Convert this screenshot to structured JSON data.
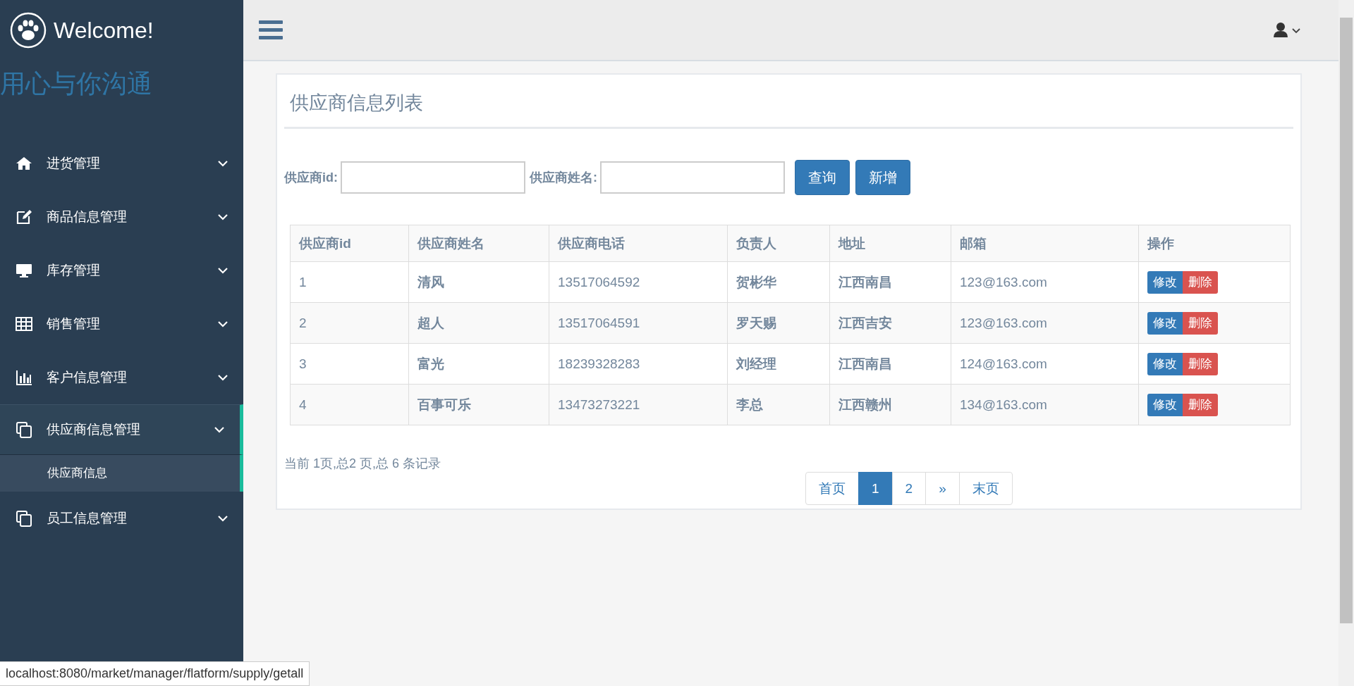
{
  "sidebar": {
    "brand": "Welcome!",
    "slogan": "用心与你沟通",
    "items": [
      {
        "label": "进货管理",
        "expanded": false
      },
      {
        "label": "商品信息管理",
        "expanded": false
      },
      {
        "label": "库存管理",
        "expanded": false
      },
      {
        "label": "销售管理",
        "expanded": false
      },
      {
        "label": "客户信息管理",
        "expanded": false
      },
      {
        "label": "供应商信息管理",
        "expanded": true,
        "children": [
          {
            "label": "供应商信息",
            "selected": true
          }
        ]
      },
      {
        "label": "员工信息管理",
        "expanded": false
      }
    ]
  },
  "panel": {
    "title": "供应商信息列表",
    "filters": [
      {
        "label": "供应商id:"
      },
      {
        "label": "供应商姓名:"
      }
    ],
    "buttons": [
      "查询",
      "新增"
    ],
    "table": {
      "columns": [
        "供应商id",
        "供应商姓名",
        "供应商电话",
        "负责人",
        "地址",
        "邮箱",
        "操作"
      ],
      "rows": [
        {
          "cells": [
            "1",
            "清风",
            "13517064592",
            "贺彬华",
            "江西南昌",
            "123@163.com"
          ],
          "actions": [
            "修改",
            "删除"
          ]
        },
        {
          "cells": [
            "2",
            "超人",
            "13517064591",
            "罗天赐",
            "江西吉安",
            "123@163.com"
          ],
          "actions": [
            "修改",
            "删除"
          ]
        },
        {
          "cells": [
            "3",
            "富光",
            "18239328283",
            "刘经理",
            "江西南昌",
            "124@163.com"
          ],
          "actions": [
            "修改",
            "删除"
          ]
        },
        {
          "cells": [
            "4",
            "百事可乐",
            "13473273221",
            "李总",
            "江西赣州",
            "134@163.com"
          ],
          "actions": [
            "修改",
            "删除"
          ]
        }
      ]
    },
    "summary": "当前 1页,总2 页,总 6 条记录",
    "pagination": [
      {
        "label": "首页",
        "selected": false
      },
      {
        "label": "1",
        "selected": true
      },
      {
        "label": "2",
        "selected": false
      },
      {
        "label": "»",
        "selected": false
      },
      {
        "label": "末页",
        "selected": false
      }
    ]
  },
  "status_bar": {
    "url": "localhost:8080/market/manager/flatform/supply/getall"
  }
}
